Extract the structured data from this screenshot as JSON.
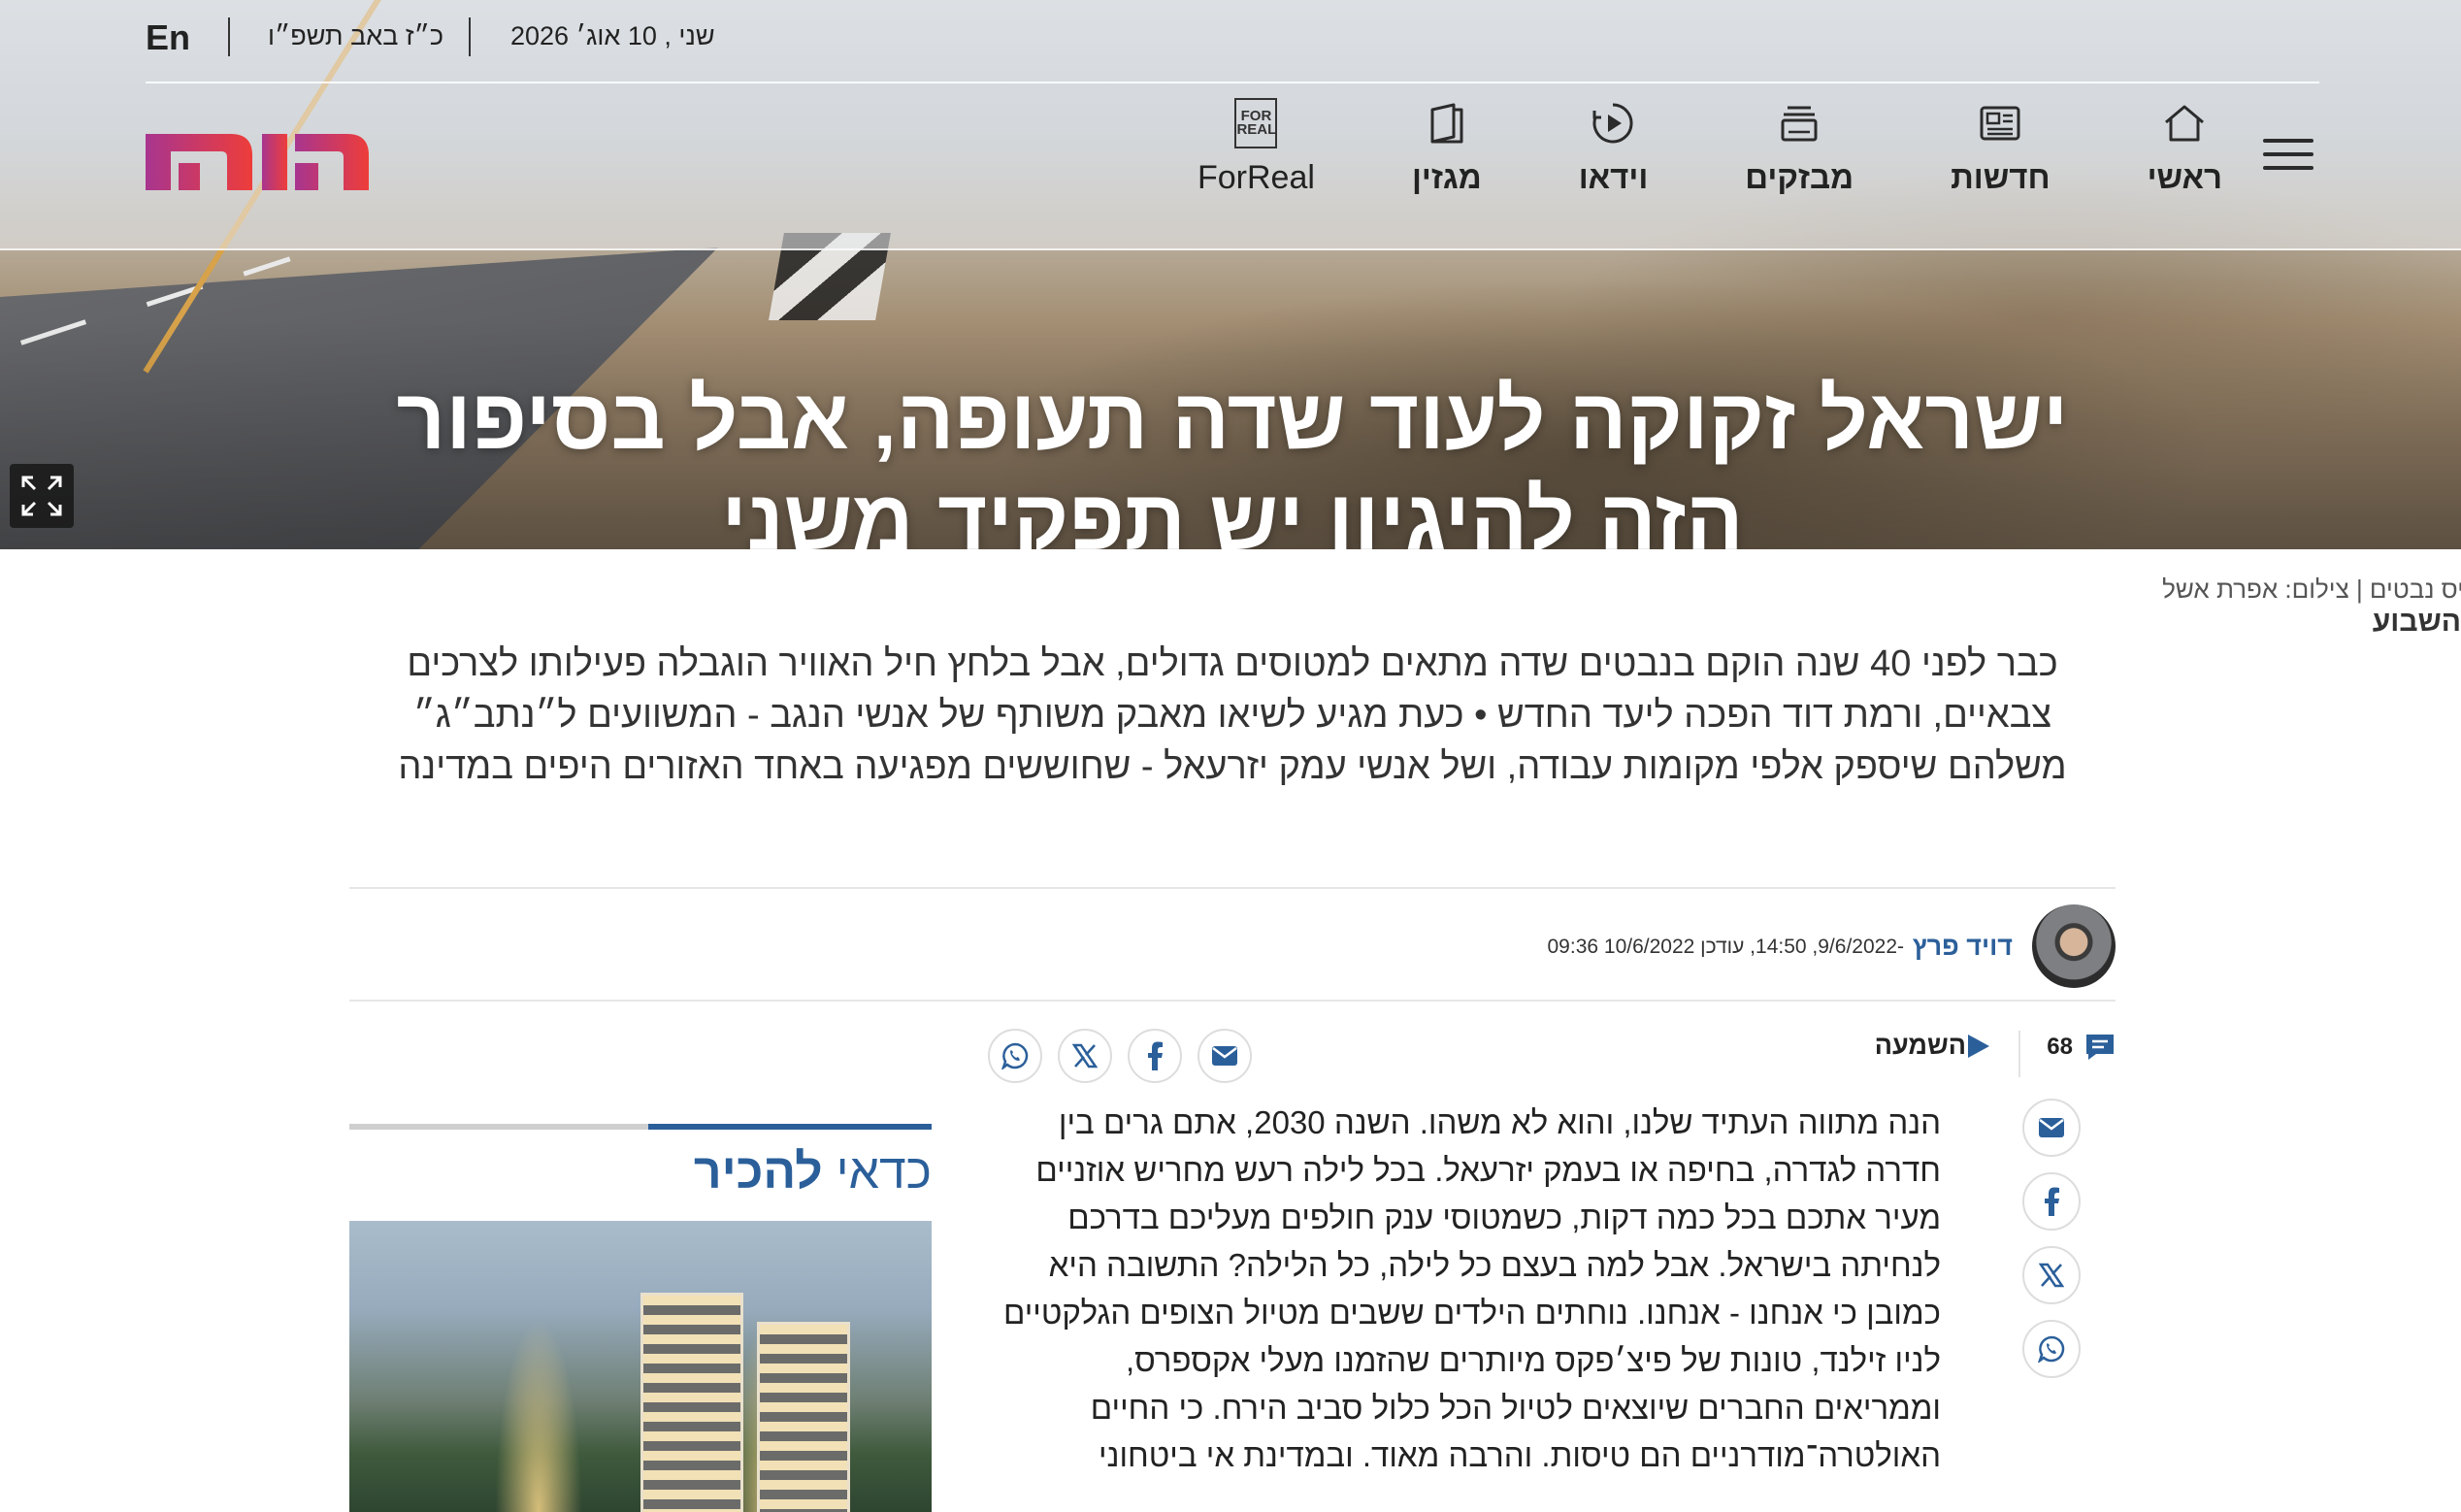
{
  "header": {
    "lang": "En",
    "hebrew_date": "כ״ז באב תשפ״ו",
    "greg_date": "שני , 10 אוג׳ 2026",
    "logo_text": "היום",
    "nav": [
      {
        "label": "ראשי",
        "icon": "home-icon"
      },
      {
        "label": "חדשות",
        "icon": "newspaper-icon"
      },
      {
        "label": "מבזקים",
        "icon": "stack-icon"
      },
      {
        "label": "וידאו",
        "icon": "video-play-icon"
      },
      {
        "label": "מגזין",
        "icon": "magazine-icon"
      },
      {
        "label": "ForReal",
        "icon": "forreal-icon",
        "icon_text": [
          "FOR",
          "REAL"
        ]
      }
    ]
  },
  "hero": {
    "title_line1": "ישראל זקוקה לעוד שדה תעופה, אבל בסיפור",
    "title_line2": "הזה להיגיון יש תפקיד משני"
  },
  "article": {
    "photo_credit": "סיס נבטים | צילום: אפרת אשל",
    "credit_tail": "השבוע",
    "subtitle": "כבר לפני 40 שנה הוקם בנבטים שדה מתאים למטוסים גדולים, אבל בלחץ חיל האוויר הוגבלה פעילותו לצרכים צבאיים, ורמת דוד הפכה ליעד החדש • כעת מגיע לשיאו מאבק משותף של אנשי הנגב - המשוועים ל״נתב״ג״ משלהם שיספק אלפי מקומות עבודה, ושל אנשי עמק יזרעאל - שחוששים מפגיעה באחד האזורים היפים במדינה",
    "author": "דויד פרץ",
    "dates": "-9/6/2022, 14:50, עודכן 10/6/2022 09:36",
    "comments_count": "68",
    "listen_label": "השמעה",
    "body": "הנה מתווה העתיד שלנו, והוא לא משהו. השנה 2030, אתם גרים בין חדרה לגדרה, בחיפה או בעמק יזרעאל. בכל לילה רעש מחריש אוזניים מעיר אתכם בכל כמה דקות, כשמטוסי ענק חולפים מעליכם בדרכם לנחיתה בישראל. אבל למה בעצם כל לילה, כל הלילה? התשובה היא כמובן כי אנחנו - אנחנו. נוחתים הילדים ששבים מטיול הצופים הגלקטיים לניו זילנד, טונות של פיצ׳פקס מיותרים שהזמנו מעלי אקספרס, וממריאים החברים שיוצאים לטיול הכל כלול סביב הירח. כי החיים האולטרה־מודרניים הם טיסות. והרבה מאוד. ובמדינת אי ביטחוני"
  },
  "recommend": {
    "title_light": "כדאי",
    "title_bold": "להכיר"
  },
  "colors": {
    "accent": "#2b5f9a",
    "logo_start": "#a8358f",
    "logo_end": "#ee3d3a"
  }
}
